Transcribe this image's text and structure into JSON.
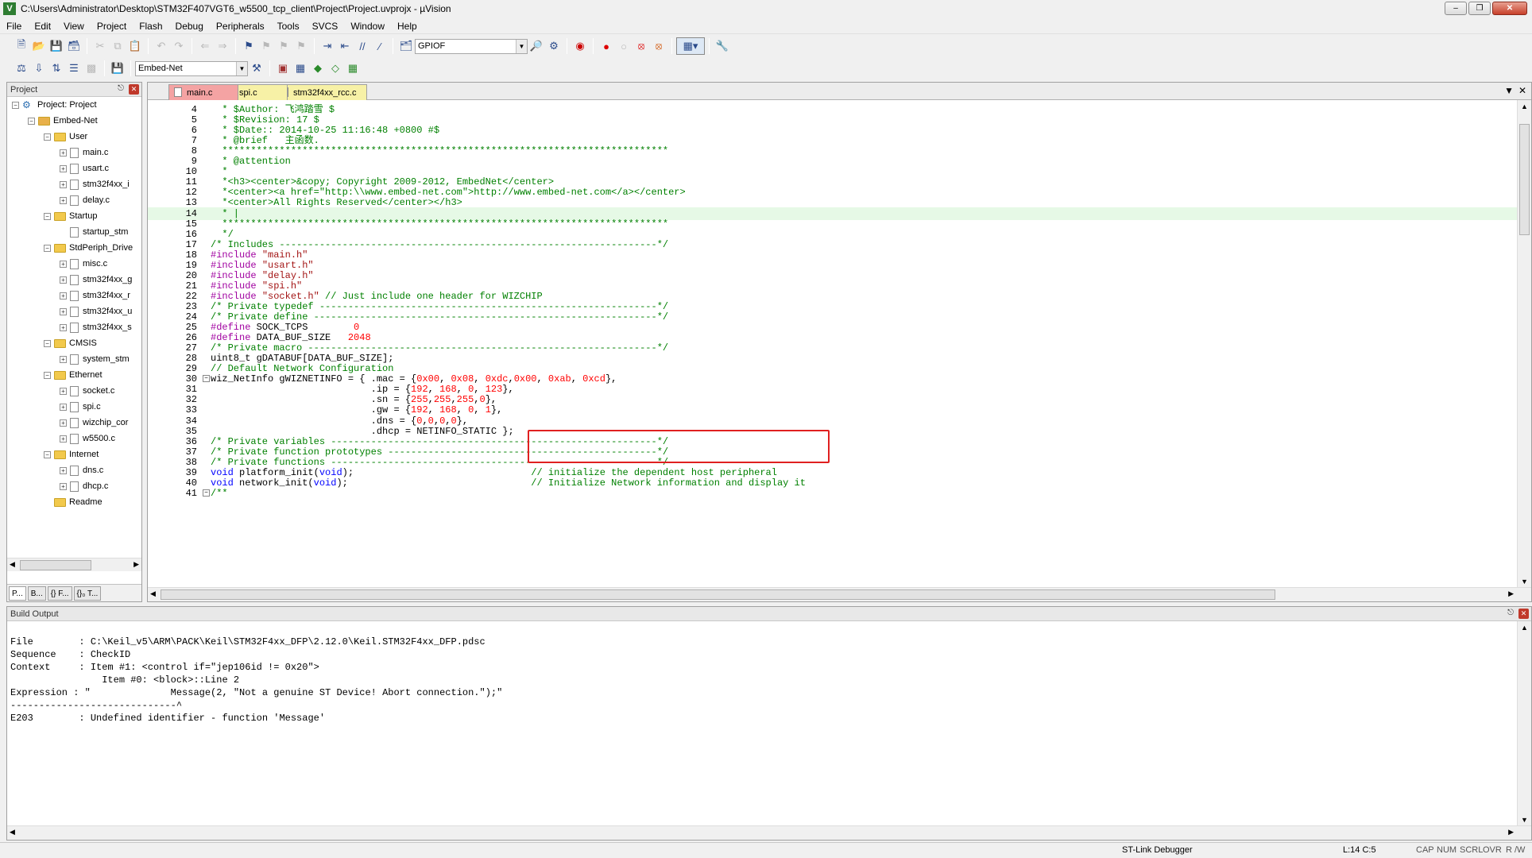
{
  "window": {
    "title": "C:\\Users\\Administrator\\Desktop\\STM32F407VGT6_w5500_tcp_client\\Project\\Project.uvprojx - µVision"
  },
  "menu": [
    "File",
    "Edit",
    "View",
    "Project",
    "Flash",
    "Debug",
    "Peripherals",
    "Tools",
    "SVCS",
    "Window",
    "Help"
  ],
  "toolbar": {
    "find_combo": "GPIOF",
    "target_combo": "Embed-Net"
  },
  "project_panel": {
    "title": "Project",
    "tree": [
      {
        "label": "Project: Project",
        "depth": 0,
        "kind": "project",
        "exp": "-"
      },
      {
        "label": "Embed-Net",
        "depth": 1,
        "kind": "target",
        "exp": "-"
      },
      {
        "label": "User",
        "depth": 2,
        "kind": "folder",
        "exp": "-"
      },
      {
        "label": "main.c",
        "depth": 3,
        "kind": "file",
        "exp": "+"
      },
      {
        "label": "usart.c",
        "depth": 3,
        "kind": "file",
        "exp": "+"
      },
      {
        "label": "stm32f4xx_i",
        "depth": 3,
        "kind": "file",
        "exp": "+"
      },
      {
        "label": "delay.c",
        "depth": 3,
        "kind": "file",
        "exp": "+"
      },
      {
        "label": "Startup",
        "depth": 2,
        "kind": "folder",
        "exp": "-"
      },
      {
        "label": "startup_stm",
        "depth": 3,
        "kind": "file",
        "exp": ""
      },
      {
        "label": "StdPeriph_Drive",
        "depth": 2,
        "kind": "folder",
        "exp": "-"
      },
      {
        "label": "misc.c",
        "depth": 3,
        "kind": "file",
        "exp": "+"
      },
      {
        "label": "stm32f4xx_g",
        "depth": 3,
        "kind": "file",
        "exp": "+"
      },
      {
        "label": "stm32f4xx_r",
        "depth": 3,
        "kind": "file",
        "exp": "+"
      },
      {
        "label": "stm32f4xx_u",
        "depth": 3,
        "kind": "file",
        "exp": "+"
      },
      {
        "label": "stm32f4xx_s",
        "depth": 3,
        "kind": "file",
        "exp": "+"
      },
      {
        "label": "CMSIS",
        "depth": 2,
        "kind": "folder",
        "exp": "-"
      },
      {
        "label": "system_stm",
        "depth": 3,
        "kind": "file",
        "exp": "+"
      },
      {
        "label": "Ethernet",
        "depth": 2,
        "kind": "folder",
        "exp": "-"
      },
      {
        "label": "socket.c",
        "depth": 3,
        "kind": "file",
        "exp": "+"
      },
      {
        "label": "spi.c",
        "depth": 3,
        "kind": "file",
        "exp": "+"
      },
      {
        "label": "wizchip_cor",
        "depth": 3,
        "kind": "file",
        "exp": "+"
      },
      {
        "label": "w5500.c",
        "depth": 3,
        "kind": "file",
        "exp": "+"
      },
      {
        "label": "Internet",
        "depth": 2,
        "kind": "folder",
        "exp": "-"
      },
      {
        "label": "dns.c",
        "depth": 3,
        "kind": "file",
        "exp": "+"
      },
      {
        "label": "dhcp.c",
        "depth": 3,
        "kind": "file",
        "exp": "+"
      },
      {
        "label": "Readme",
        "depth": 2,
        "kind": "folder",
        "exp": ""
      }
    ],
    "bottom_tabs": [
      "P...",
      "B...",
      "{} F...",
      "{}₀ T..."
    ]
  },
  "editor": {
    "tabs": [
      "main.c",
      "spi.c",
      "stm32f4xx_rcc.c"
    ],
    "lines": [
      {
        "n": "4",
        "html": "<span class=\"c\">  * $Author: 飞鸿踏雪 $</span>"
      },
      {
        "n": "5",
        "html": "<span class=\"c\">  * $Revision: 17 $</span>"
      },
      {
        "n": "6",
        "html": "<span class=\"c\">  * $Date:: 2014-10-25 11:16:48 +0800 #$</span>"
      },
      {
        "n": "7",
        "html": "<span class=\"c\">  * @brief   主函数.</span>"
      },
      {
        "n": "8",
        "html": "<span class=\"c\">  ******************************************************************************</span>"
      },
      {
        "n": "9",
        "html": "<span class=\"c\">  * @attention</span>"
      },
      {
        "n": "10",
        "html": "<span class=\"c\">  *</span>"
      },
      {
        "n": "11",
        "html": "<span class=\"c\">  *&lt;h3&gt;&lt;center&gt;&amp;copy; Copyright 2009-2012, EmbedNet&lt;/center&gt;</span>"
      },
      {
        "n": "12",
        "html": "<span class=\"c\">  *&lt;center&gt;&lt;a href=\"http:\\\\www.embed-net.com\"&gt;http://www.embed-net.com&lt;/a&gt;&lt;/center&gt;</span>"
      },
      {
        "n": "13",
        "html": "<span class=\"c\">  *&lt;center&gt;All Rights Reserved&lt;/center&gt;&lt;/h3&gt;</span>"
      },
      {
        "n": "14",
        "html": "<span class=\"c\">  * |</span>",
        "cur": true
      },
      {
        "n": "15",
        "html": "<span class=\"c\">  ******************************************************************************</span>"
      },
      {
        "n": "16",
        "html": "<span class=\"c\">  */</span>"
      },
      {
        "n": "17",
        "html": "<span class=\"c\">/* Includes ------------------------------------------------------------------*/</span>"
      },
      {
        "n": "18",
        "html": "<span class=\"pp\">#include</span> <span class=\"str\">\"main.h\"</span>"
      },
      {
        "n": "19",
        "html": "<span class=\"pp\">#include</span> <span class=\"str\">\"usart.h\"</span>"
      },
      {
        "n": "20",
        "html": "<span class=\"pp\">#include</span> <span class=\"str\">\"delay.h\"</span>"
      },
      {
        "n": "21",
        "html": "<span class=\"pp\">#include</span> <span class=\"str\">\"spi.h\"</span>"
      },
      {
        "n": "22",
        "html": "<span class=\"pp\">#include</span> <span class=\"str\">\"socket.h\"</span> <span class=\"c\">// Just include one header for WIZCHIP</span>"
      },
      {
        "n": "23",
        "html": "<span class=\"c\">/* Private typedef -----------------------------------------------------------*/</span>"
      },
      {
        "n": "24",
        "html": "<span class=\"c\">/* Private define ------------------------------------------------------------*/</span>"
      },
      {
        "n": "25",
        "html": "<span class=\"pp\">#define</span> SOCK_TCPS        <span class=\"num\">0</span>"
      },
      {
        "n": "26",
        "html": "<span class=\"pp\">#define</span> DATA_BUF_SIZE   <span class=\"num\">2048</span>"
      },
      {
        "n": "27",
        "html": "<span class=\"c\">/* Private macro -------------------------------------------------------------*/</span>"
      },
      {
        "n": "28",
        "html": "uint8_t gDATABUF[DATA_BUF_SIZE];"
      },
      {
        "n": "29",
        "html": "<span class=\"c\">// Default Network Configuration</span>"
      },
      {
        "n": "30",
        "html": "wiz_NetInfo gWIZNETINFO = { .mac = {<span class=\"num\">0x00</span>, <span class=\"num\">0x08</span>, <span class=\"num\">0xdc</span>,<span class=\"num\">0x00</span>, <span class=\"num\">0xab</span>, <span class=\"num\">0xcd</span>},",
        "fold": true
      },
      {
        "n": "31",
        "html": "                            .ip = {<span class=\"num\">192</span>, <span class=\"num\">168</span>, <span class=\"num\">0</span>, <span class=\"num\">123</span>},"
      },
      {
        "n": "32",
        "html": "                            .sn = {<span class=\"num\">255</span>,<span class=\"num\">255</span>,<span class=\"num\">255</span>,<span class=\"num\">0</span>},"
      },
      {
        "n": "33",
        "html": "                            .gw = {<span class=\"num\">192</span>, <span class=\"num\">168</span>, <span class=\"num\">0</span>, <span class=\"num\">1</span>},"
      },
      {
        "n": "34",
        "html": "                            .dns = {<span class=\"num\">0</span>,<span class=\"num\">0</span>,<span class=\"num\">0</span>,<span class=\"num\">0</span>},"
      },
      {
        "n": "35",
        "html": "                            .dhcp = NETINFO_STATIC };"
      },
      {
        "n": "36",
        "html": "<span class=\"c\">/* Private variables ---------------------------------------------------------*/</span>"
      },
      {
        "n": "37",
        "html": "<span class=\"c\">/* Private function prototypes -----------------------------------------------*/</span>"
      },
      {
        "n": "38",
        "html": "<span class=\"c\">/* Private functions ---------------------------------------------------------*/</span>"
      },
      {
        "n": "39",
        "html": "<span class=\"kw\">void</span> platform_init(<span class=\"kw\">void</span>);                               <span class=\"c\">// initialize the dependent host peripheral</span>"
      },
      {
        "n": "40",
        "html": "<span class=\"kw\">void</span> network_init(<span class=\"kw\">void</span>);                                <span class=\"c\">// Initialize Network information and display it</span>"
      },
      {
        "n": "41",
        "html": "<span class=\"c\">/**</span>",
        "fold": true
      }
    ]
  },
  "build_output": {
    "title": "Build Output",
    "text": "File        : C:\\Keil_v5\\ARM\\PACK\\Keil\\STM32F4xx_DFP\\2.12.0\\Keil.STM32F4xx_DFP.pdsc\nSequence    : CheckID\nContext     : Item #1: <control if=\"jep106id != 0x20\">\n                Item #0: <block>::Line 2\nExpression : \"              Message(2, \"Not a genuine ST Device! Abort connection.\");\"\n-----------------------------^\nE203        : Undefined identifier - function 'Message'"
  },
  "status": {
    "debugger": "ST-Link Debugger",
    "position": "L:14 C:5",
    "caps": "CAP",
    "num": "NUM",
    "scrl": "SCRL",
    "ovr": "OVR",
    "rw": "R /W"
  }
}
